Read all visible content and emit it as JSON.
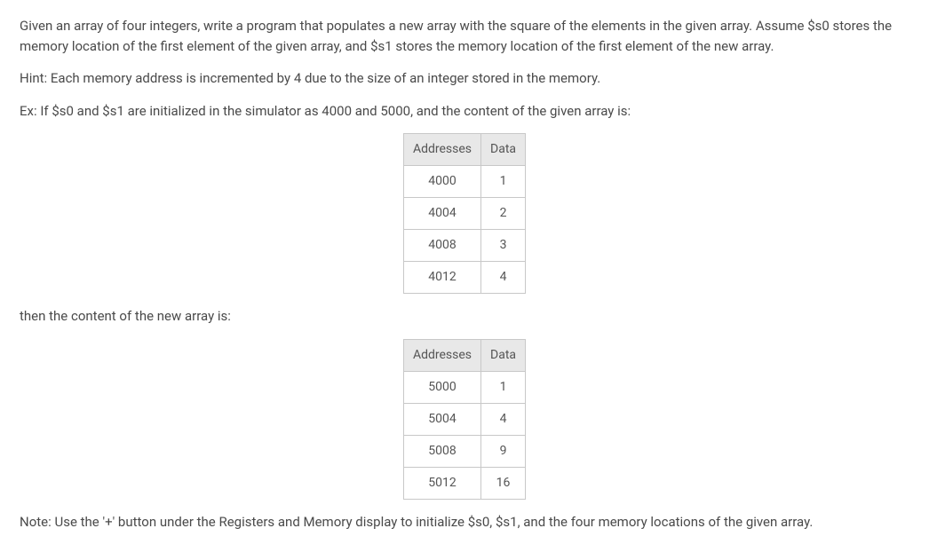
{
  "paragraphs": {
    "p1": "Given an array of four integers, write a program that populates a new array with the square of the elements in the given array. Assume $s0 stores the memory location of the first element of the given array, and $s1 stores the memory location of the first element of the new array.",
    "p2": "Hint: Each memory address is incremented by 4 due to the size of an integer stored in the memory.",
    "p3": "Ex: If $s0 and $s1 are initialized in the simulator as 4000 and 5000, and the content of the given array is:",
    "p4": "then the content of the new array is:",
    "p5": "Note: Use the '+' button under the Registers and Memory display to initialize $s0, $s1, and the four memory locations of the given array."
  },
  "table_headers": {
    "addresses": "Addresses",
    "data": "Data"
  },
  "table1": {
    "rows": [
      {
        "addr": "4000",
        "data": "1"
      },
      {
        "addr": "4004",
        "data": "2"
      },
      {
        "addr": "4008",
        "data": "3"
      },
      {
        "addr": "4012",
        "data": "4"
      }
    ]
  },
  "table2": {
    "rows": [
      {
        "addr": "5000",
        "data": "1"
      },
      {
        "addr": "5004",
        "data": "4"
      },
      {
        "addr": "5008",
        "data": "9"
      },
      {
        "addr": "5012",
        "data": "16"
      }
    ]
  }
}
